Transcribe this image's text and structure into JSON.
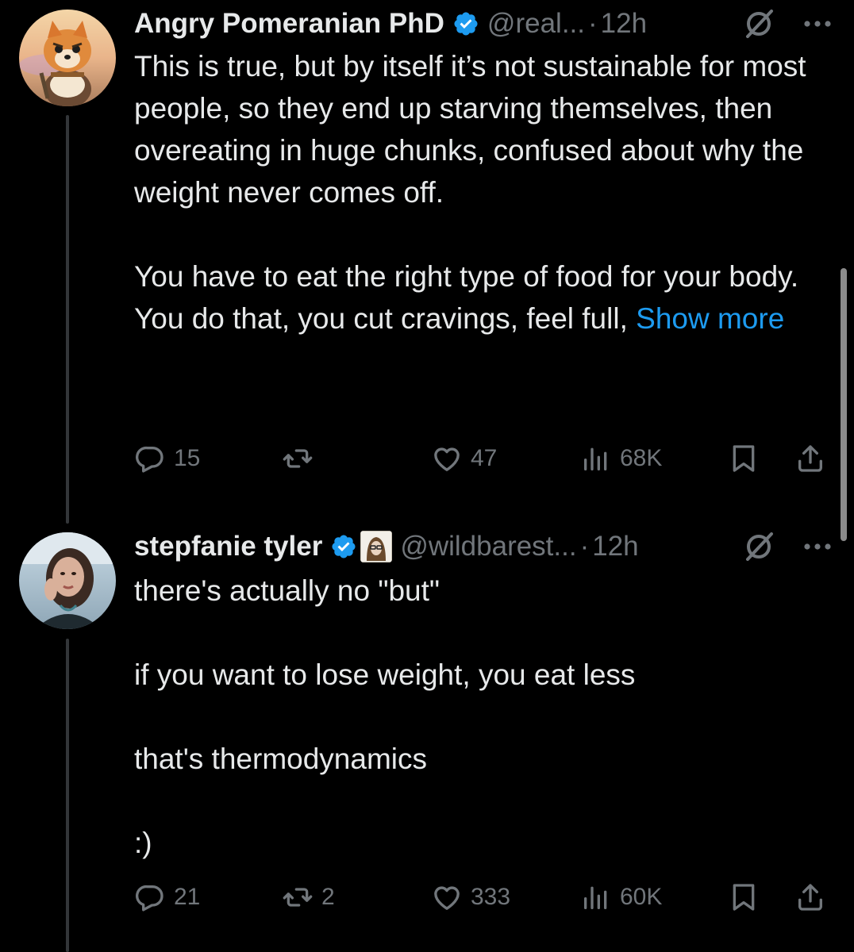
{
  "colors": {
    "background": "#000000",
    "text": "#e7e9ea",
    "muted": "#71767b",
    "link": "#1d9bf0",
    "verified": "#1d9bf0"
  },
  "tweets": [
    {
      "display_name": "Angry Pomeranian PhD",
      "handle": "@real...",
      "separator": "·",
      "time": "12h",
      "verified_icon": "verified-badge-icon",
      "paragraphs": [
        "This is true, but by itself it’s not sustainable for most people, so they end up starving themselves, then overeating in huge chunks, confused about why the weight never comes off.",
        "You have to eat the right type of food for your body. You do that, you cut cravings, feel full,"
      ],
      "show_more": "Show more",
      "counts": {
        "replies": "15",
        "reposts": "",
        "likes": "47",
        "views": "68K"
      }
    },
    {
      "display_name": "stepfanie tyler",
      "handle": "@wildbarest...",
      "separator": "·",
      "time": "12h",
      "verified_icon": "verified-badge-icon",
      "affiliate_icon": "affiliate-badge-icon",
      "paragraphs": [
        "there's actually no \"but\"",
        "if you want to lose weight, you eat less",
        "that's thermodynamics",
        ":)"
      ],
      "counts": {
        "replies": "21",
        "reposts": "2",
        "likes": "333",
        "views": "60K"
      }
    }
  ]
}
